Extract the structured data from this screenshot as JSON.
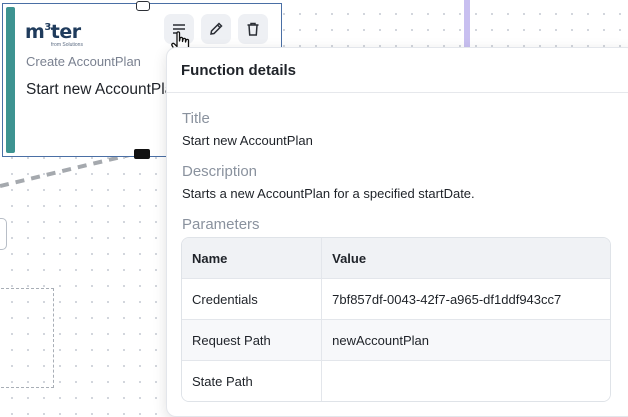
{
  "node": {
    "logo": {
      "brand": "m",
      "sup": "3",
      "rest": "ter",
      "tagline": "from Solutions"
    },
    "subtitle": "Create AccountPlan",
    "title": "Start new AccountPlan"
  },
  "toolbar": {
    "details_icon": "list-details-icon",
    "edit_icon": "pencil-icon",
    "delete_icon": "trash-icon"
  },
  "popover": {
    "title": "Function details",
    "title_label": "Title",
    "title_value": "Start new AccountPlan",
    "description_label": "Description",
    "description_value": "Starts a new AccountPlan for a specified startDate.",
    "parameters_label": "Parameters",
    "table": {
      "headers": [
        "Name",
        "Value"
      ],
      "rows": [
        {
          "name": "Credentials",
          "value": "7bf857df-0043-42f7-a965-df1ddf943cc7"
        },
        {
          "name": "Request Path",
          "value": "newAccountPlan"
        },
        {
          "name": "State Path",
          "value": ""
        }
      ]
    }
  },
  "colors": {
    "accent": "#3d9391",
    "node_border": "#4a6fa5",
    "text": "#1e2228",
    "muted": "#8a929e"
  }
}
